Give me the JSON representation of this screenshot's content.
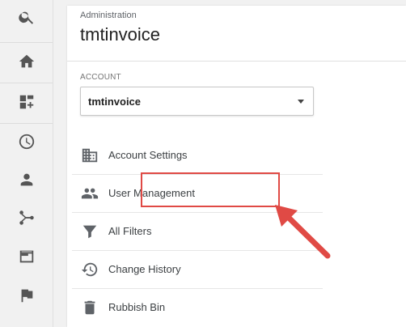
{
  "rail": {
    "items": [
      {
        "icon": "search-icon",
        "name": "rail-search"
      },
      {
        "icon": "home-icon",
        "name": "rail-home"
      },
      {
        "icon": "dashboards-icon",
        "name": "rail-customisation"
      },
      {
        "icon": "clock-icon",
        "name": "rail-realtime"
      },
      {
        "icon": "person-icon",
        "name": "rail-audience"
      },
      {
        "icon": "acquisition-icon",
        "name": "rail-acquisition"
      },
      {
        "icon": "behaviour-icon",
        "name": "rail-behaviour"
      },
      {
        "icon": "flag-icon",
        "name": "rail-conversions"
      }
    ]
  },
  "header": {
    "section": "Administration",
    "title": "tmtinvoice"
  },
  "account": {
    "label": "ACCOUNT",
    "selected": "tmtinvoice"
  },
  "menu": {
    "items": [
      {
        "label": "Account Settings",
        "icon": "building-icon"
      },
      {
        "label": "User Management",
        "icon": "people-icon",
        "highlighted": true
      },
      {
        "label": "All Filters",
        "icon": "filter-icon"
      },
      {
        "label": "Change History",
        "icon": "history-icon"
      },
      {
        "label": "Rubbish Bin",
        "icon": "trash-icon"
      }
    ]
  },
  "colors": {
    "highlight": "#e04a45",
    "icon": "#5f6368"
  }
}
